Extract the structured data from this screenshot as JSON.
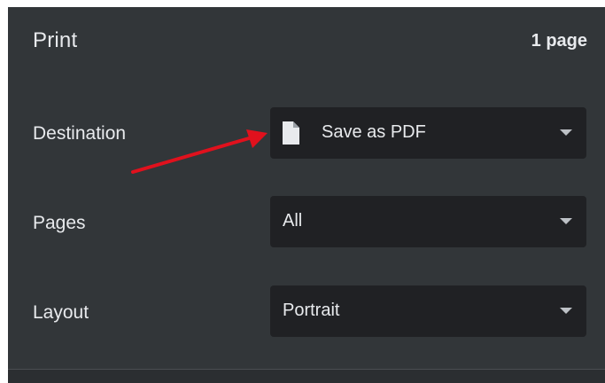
{
  "dialog": {
    "title": "Print",
    "page_count": "1 page"
  },
  "rows": {
    "destination": {
      "label": "Destination",
      "value": "Save as PDF",
      "icon": "document-icon"
    },
    "pages": {
      "label": "Pages",
      "value": "All"
    },
    "layout": {
      "label": "Layout",
      "value": "Portrait"
    }
  },
  "annotation": {
    "arrow_color": "#e0111d"
  },
  "colors": {
    "panel_bg": "#323639",
    "select_bg": "#202124",
    "text": "#e8eaed",
    "caret": "#bdc1c6"
  }
}
